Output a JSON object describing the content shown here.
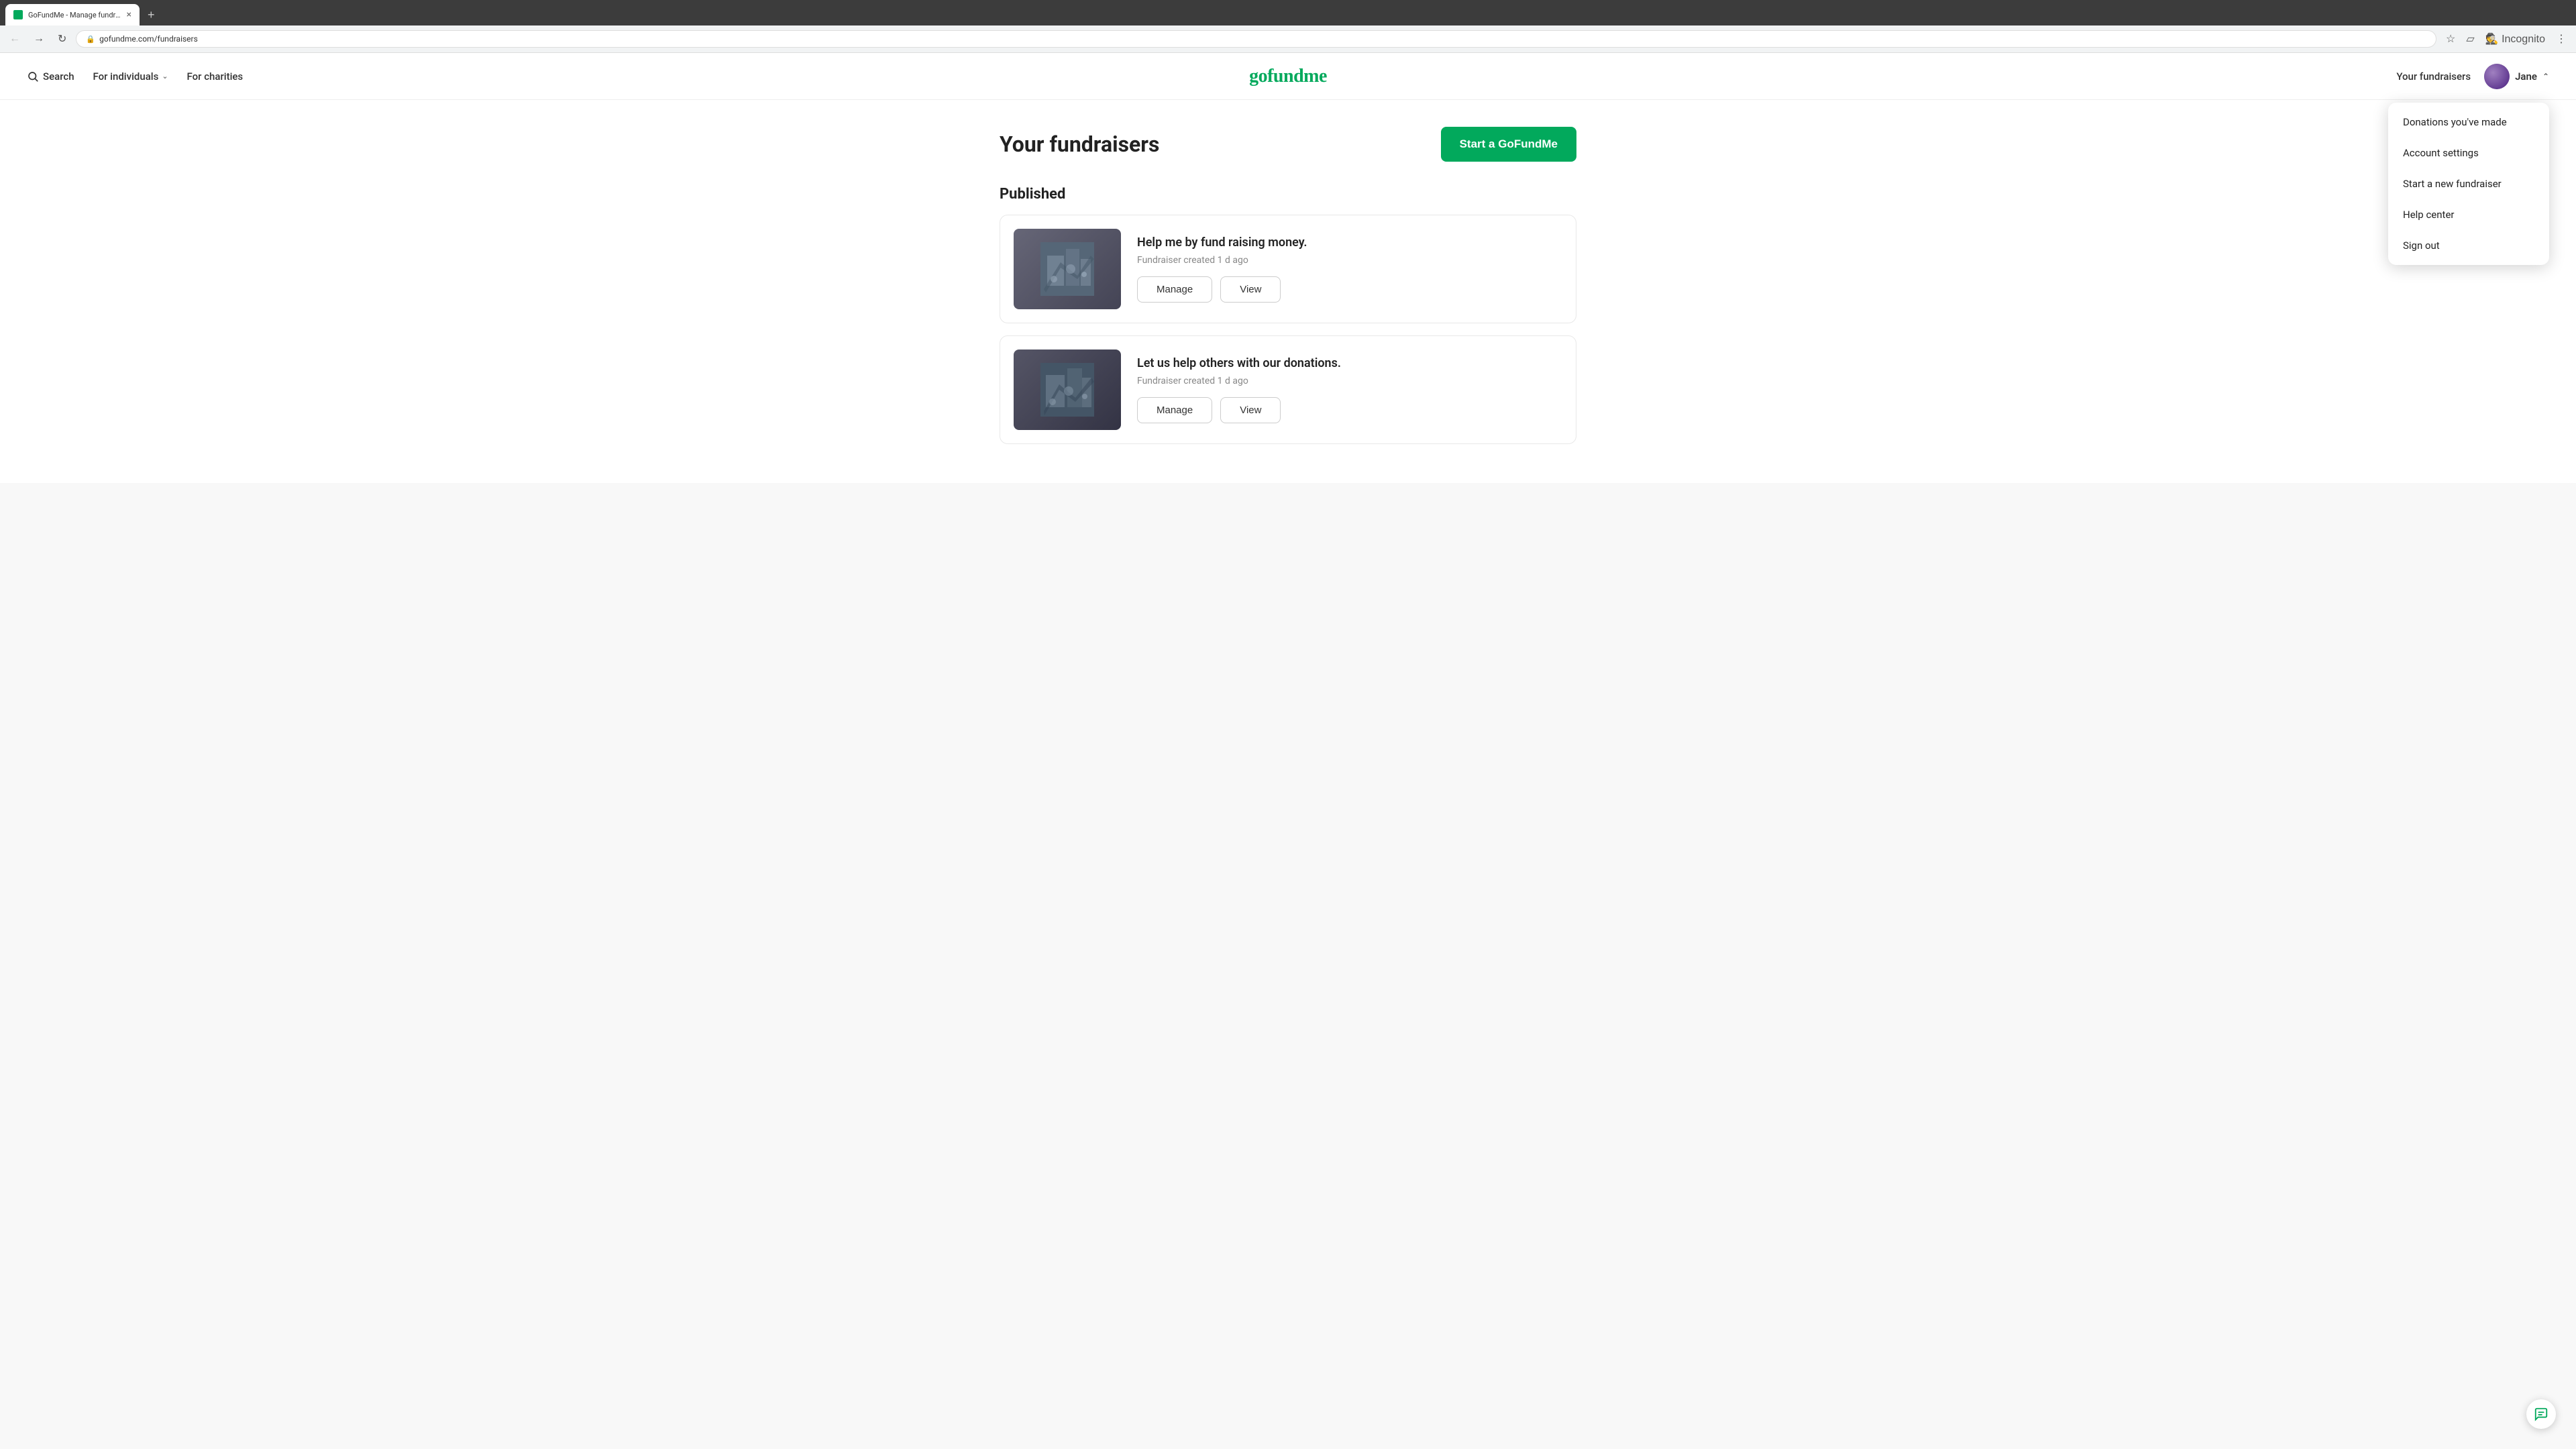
{
  "browser": {
    "tab_favicon": "G",
    "tab_title": "GoFundMe - Manage fundraise...",
    "tab_close": "×",
    "new_tab": "+",
    "back_tooltip": "Back",
    "forward_tooltip": "Forward",
    "reload_tooltip": "Reload",
    "address": "gofundme.com/fundraisers",
    "incognito_label": "Incognito",
    "menu_icon": "⋮"
  },
  "nav": {
    "search_label": "Search",
    "for_individuals_label": "For individuals",
    "for_charities_label": "For charities",
    "logo_text": "gofundme",
    "your_fundraisers_label": "Your fundraisers",
    "user_name": "Jane",
    "chevron": "∧"
  },
  "dropdown": {
    "items": [
      {
        "id": "donations",
        "label": "Donations you've made"
      },
      {
        "id": "account-settings",
        "label": "Account settings"
      },
      {
        "id": "start-fundraiser",
        "label": "Start a new fundraiser"
      },
      {
        "id": "help-center",
        "label": "Help center"
      },
      {
        "id": "sign-out",
        "label": "Sign out"
      }
    ]
  },
  "main": {
    "page_title": "Your fundraisers",
    "start_button_label": "Start a GoFundMe",
    "published_section_title": "Published",
    "fundraisers": [
      {
        "id": "f1",
        "title": "Help me by fund raising money.",
        "meta": "Fundraiser created 1 d ago",
        "manage_label": "Manage",
        "view_label": "View"
      },
      {
        "id": "f2",
        "title": "Let us help others with our donations.",
        "meta": "Fundraiser created 1 d ago",
        "manage_label": "Manage",
        "view_label": "View"
      }
    ]
  },
  "colors": {
    "brand_green": "#02a95c",
    "text_dark": "#222222",
    "text_muted": "#888888"
  }
}
